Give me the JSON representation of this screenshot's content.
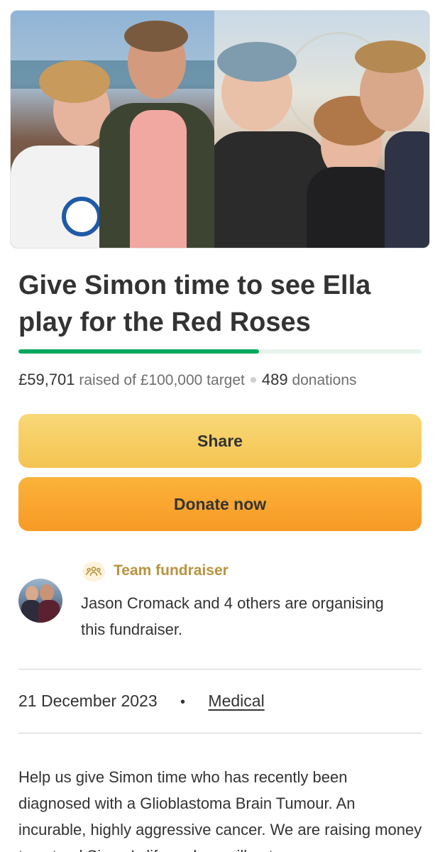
{
  "hero": {
    "left_photo": "campaign-photo-ella-and-simon",
    "right_photo": "campaign-photo-family-selfie"
  },
  "campaign": {
    "title": "Give Simon time to see Ella play for the Red Roses",
    "progress_fraction": 0.597,
    "raised_amount": "£59,701",
    "raised_text": "raised of £100,000 target",
    "donation_count": "489",
    "donations_label": "donations"
  },
  "actions": {
    "share_label": "Share",
    "donate_label": "Donate now"
  },
  "organiser": {
    "badge_icon": "team-icon",
    "badge_label": "Team fundraiser",
    "description": "Jason Cromack and 4 others are organising this fundraiser."
  },
  "meta": {
    "date": "21 December 2023",
    "separator": "•",
    "category": "Medical"
  },
  "story": {
    "text": "Help us give Simon time who has recently been diagnosed with a Glioblastoma Brain Tumour. An incurable, highly aggressive cancer. We are raising money to extend Simon's life and we will not..."
  },
  "colors": {
    "progress": "#02a95c",
    "share_button": "#f6ce63",
    "donate_button": "#f9a52d",
    "team_label": "#b9933e"
  }
}
